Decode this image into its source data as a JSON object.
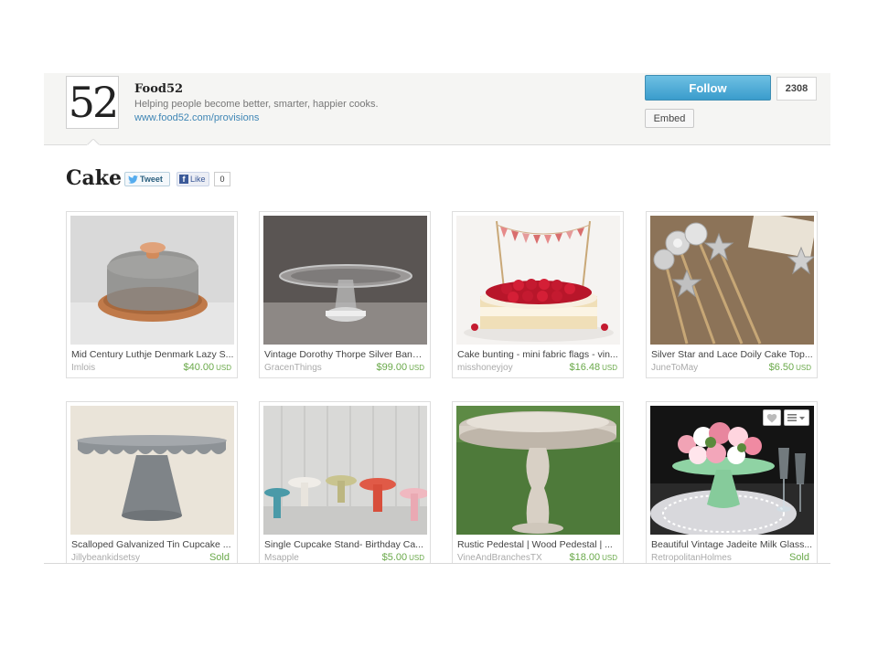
{
  "shop": {
    "logo_text": "52",
    "name": "Food52",
    "tagline": "Helping people become better, smarter, happier cooks.",
    "url": "www.food52.com/provisions",
    "follow_label": "Follow",
    "follower_count": "2308",
    "embed_label": "Embed"
  },
  "collection": {
    "title": "Cake",
    "tweet_label": "Tweet",
    "like_label": "Like",
    "like_count": "0"
  },
  "colors": {
    "price_green": "#6aa94a",
    "follow_blue": "#3a9ccc",
    "link_blue": "#3f86b5"
  },
  "listings": [
    {
      "title": "Mid Century Luthje Denmark Lazy S...",
      "seller": "Imlois",
      "price": "$40.00",
      "currency": "USD",
      "image": "lucite-cake-dome-on-wood-base"
    },
    {
      "title": "Vintage Dorothy Thorpe Silver Band ...",
      "seller": "GracenThings",
      "price": "$99.00",
      "currency": "USD",
      "image": "glass-cake-stand"
    },
    {
      "title": "Cake bunting - mini fabric flags - vin...",
      "seller": "misshoneyjoy",
      "price": "$16.48",
      "currency": "USD",
      "image": "raspberry-cake-with-bunting"
    },
    {
      "title": "Silver Star and Lace Doily Cake Top...",
      "seller": "JuneToMay",
      "price": "$6.50",
      "currency": "USD",
      "image": "star-cake-toppers"
    },
    {
      "title": "Scalloped Galvanized Tin Cupcake ...",
      "seller": "Jillybeankidsetsy",
      "price": "Sold",
      "currency": "",
      "image": "galvanized-tin-stand"
    },
    {
      "title": "Single Cupcake Stand- Birthday Ca...",
      "seller": "Msapple",
      "price": "$5.00",
      "currency": "USD",
      "image": "colorful-cupcake-stands"
    },
    {
      "title": "Rustic Pedestal | Wood Pedestal | ...",
      "seller": "VineAndBranchesTX",
      "price": "$18.00",
      "currency": "USD",
      "image": "rustic-wood-pedestal"
    },
    {
      "title": "Beautiful Vintage Jadeite Milk Glass...",
      "seller": "RetropolitanHolmes",
      "price": "Sold",
      "currency": "",
      "image": "jadeite-cake-stand-flowers"
    }
  ]
}
